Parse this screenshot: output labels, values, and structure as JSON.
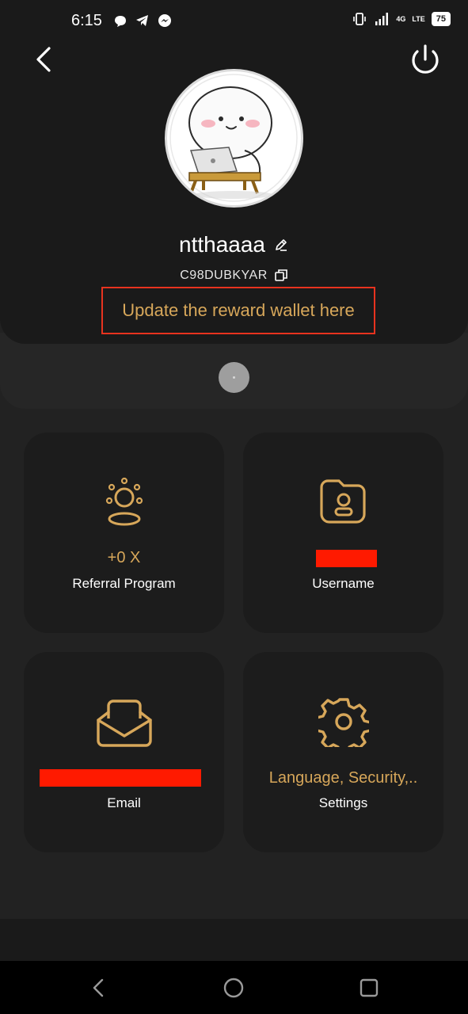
{
  "status_bar": {
    "time": "6:15",
    "network_label": "4G",
    "volte_label": "LTE",
    "battery": "75",
    "icons_left": [
      "chat-bubble-icon",
      "telegram-icon",
      "messenger-icon"
    ],
    "icons_right": [
      "vibrate-icon",
      "signal-icon",
      "volte-icon",
      "battery-icon"
    ]
  },
  "header": {
    "back_icon": "chevron-left-icon",
    "power_icon": "power-icon",
    "username": "ntthaaaa",
    "user_code": "C98DUBKYAR",
    "reward_wallet_text": "Update the reward wallet here"
  },
  "cards": {
    "referral": {
      "value": "+0 X",
      "label": "Referral Program",
      "icon": "people-icon"
    },
    "username": {
      "value_redacted": true,
      "label": "Username",
      "icon": "profile-icon"
    },
    "email": {
      "value_redacted": true,
      "label": "Email",
      "icon": "envelope-icon"
    },
    "settings": {
      "value": "Language, Security,..",
      "label": "Settings",
      "icon": "gear-icon"
    }
  },
  "colors": {
    "accent": "#d7a75a",
    "background": "#222222",
    "card": "#1c1c1c",
    "highlight_border": "#e8331f",
    "redaction": "#ff1a00"
  },
  "nav": {
    "back": "nav-back-icon",
    "home": "nav-home-icon",
    "recents": "nav-recents-icon"
  }
}
